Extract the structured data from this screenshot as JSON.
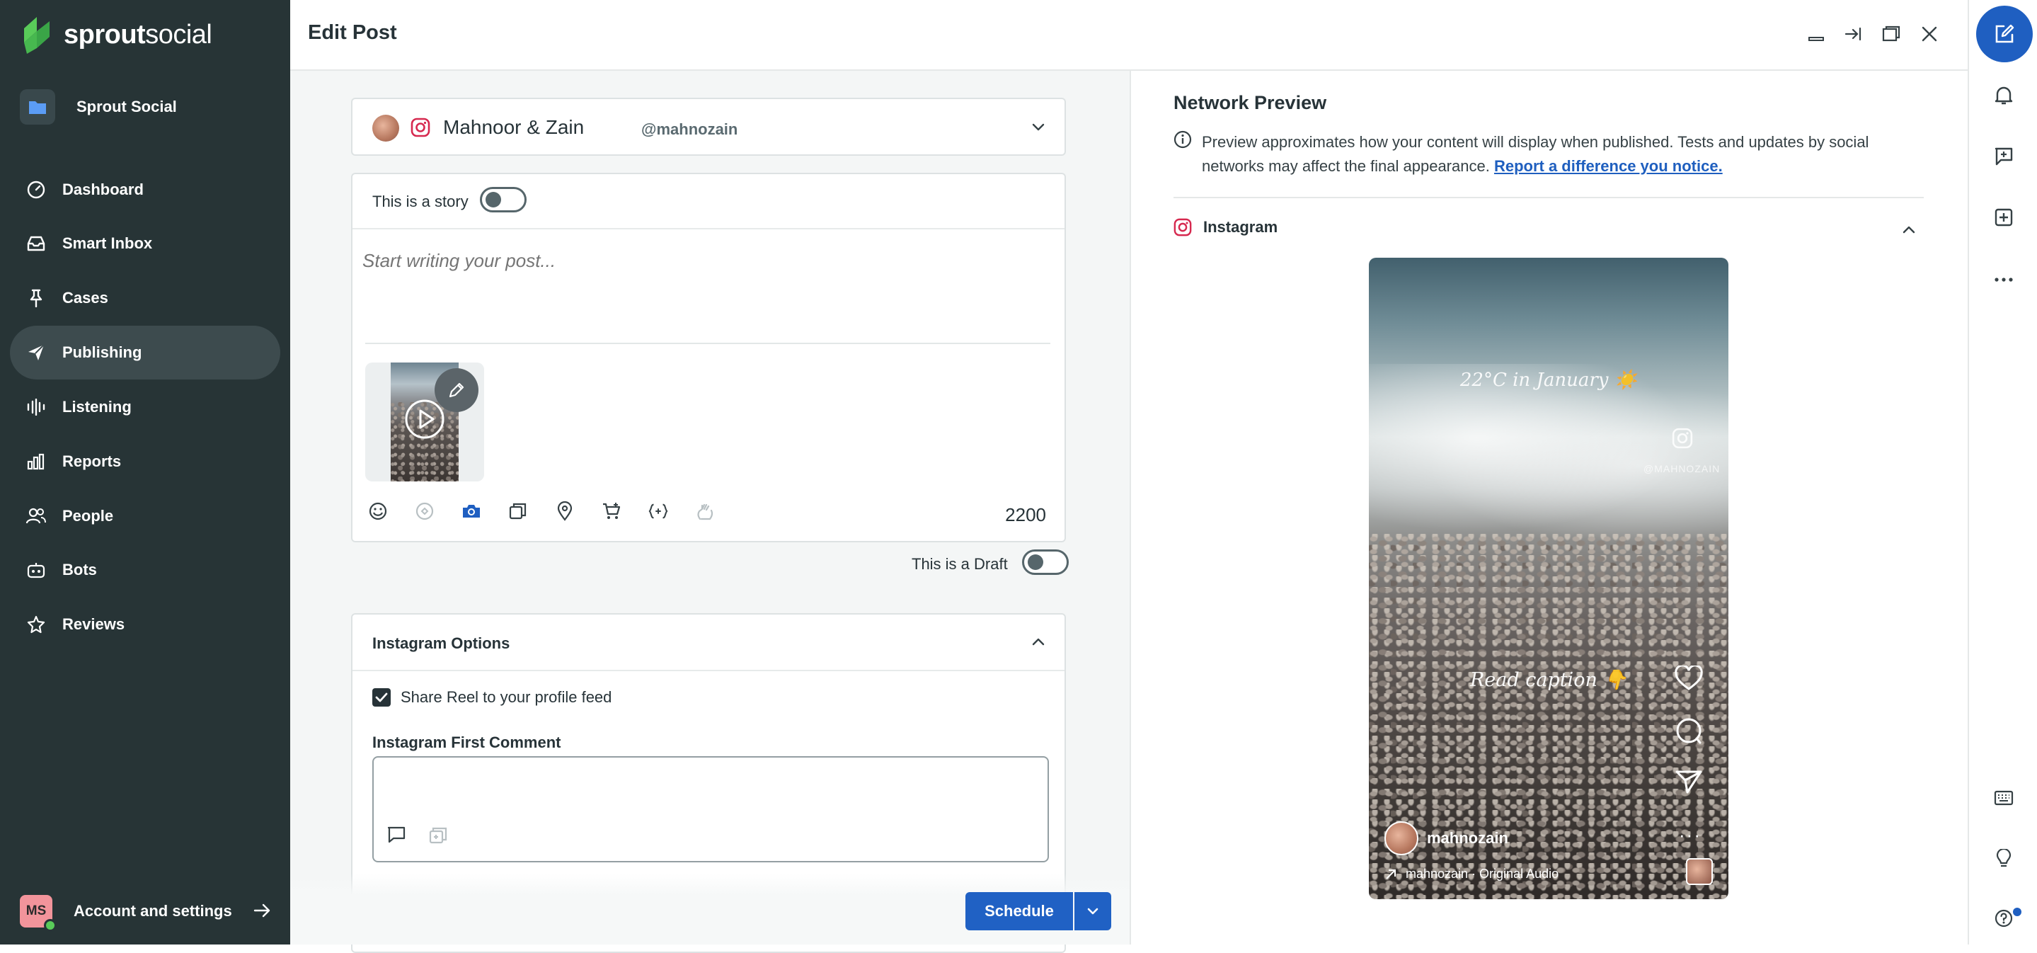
{
  "brand": {
    "logo_bold": "sprout",
    "logo_light": "social"
  },
  "workspace": {
    "label": "Sprout Social"
  },
  "sidebar": {
    "items": [
      {
        "label": "Dashboard",
        "icon": "dashboard-icon"
      },
      {
        "label": "Smart Inbox",
        "icon": "inbox-icon"
      },
      {
        "label": "Cases",
        "icon": "pin-icon"
      },
      {
        "label": "Publishing",
        "icon": "paper-plane-icon",
        "active": true
      },
      {
        "label": "Listening",
        "icon": "waveform-icon"
      },
      {
        "label": "Reports",
        "icon": "bar-chart-icon"
      },
      {
        "label": "People",
        "icon": "people-icon"
      },
      {
        "label": "Bots",
        "icon": "bot-icon"
      },
      {
        "label": "Reviews",
        "icon": "star-icon"
      }
    ]
  },
  "account": {
    "initials": "MS",
    "label": "Account and settings"
  },
  "header": {
    "title": "Edit Post"
  },
  "composer": {
    "profile_name": "Mahnoor & Zain",
    "profile_handle": "@mahnozain",
    "story_label": "This is a story",
    "post_placeholder": "Start writing your post...",
    "char_count": "2200",
    "draft_label": "This is a Draft",
    "ig_options_title": "Instagram Options",
    "share_reel_label": "Share Reel to your profile feed",
    "first_comment_label": "Instagram First Comment",
    "schedule_label": "Schedule"
  },
  "preview": {
    "title": "Network Preview",
    "desc": "Preview approximates how your content will display when published. Tests and updates by social networks may affect the final appearance.",
    "link": "Report a difference you notice.",
    "network": "Instagram",
    "caption_top": "22°C in January ☀️",
    "caption_bottom": "Read caption 👇",
    "watermark": "@MAHNOZAIN",
    "username": "mahnozain",
    "audio": "mahnozain · Original Audio",
    "more": "···"
  },
  "colors": {
    "sidebar_bg": "#273436",
    "accent": "#2061c4",
    "instagram": "#d6294f"
  }
}
